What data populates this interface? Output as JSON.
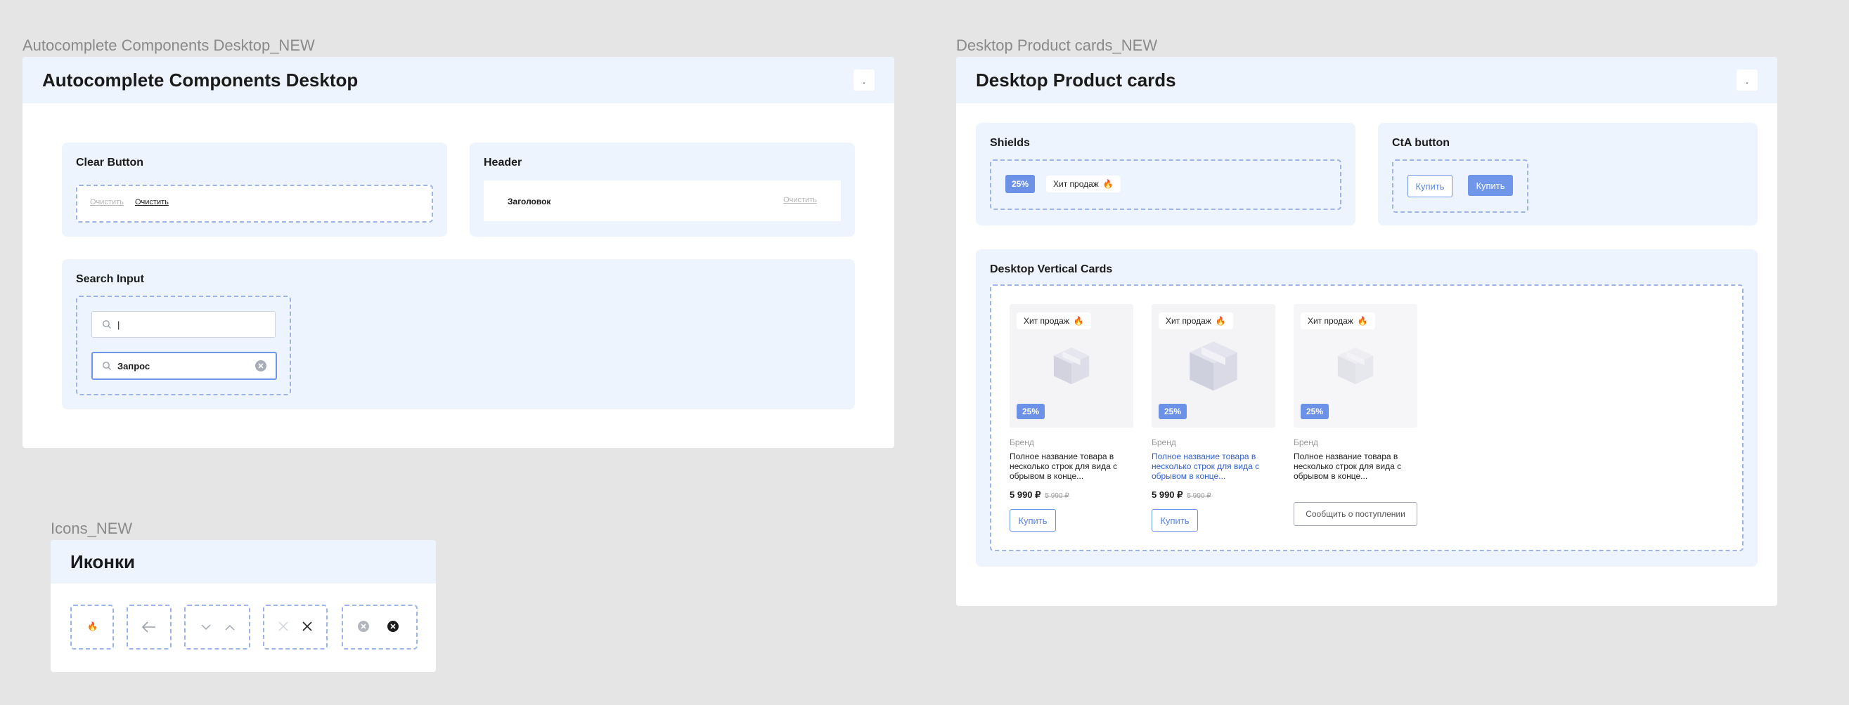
{
  "frames": {
    "autocomplete": {
      "label": "Autocomplete Components Desktop_NEW",
      "title": "Autocomplete Components Desktop",
      "dot": ".",
      "clear_button": {
        "title": "Clear Button",
        "disabled_label": "Очистить",
        "active_label": "Очистить"
      },
      "header": {
        "title": "Header",
        "heading": "Заголовок",
        "clear_label": "Очистить"
      },
      "search_input": {
        "title": "Search Input",
        "empty_value": "|",
        "filled_value": "Запрос"
      }
    },
    "icons": {
      "label": "Icons_NEW",
      "title": "Иконки",
      "items": [
        "fire-icon",
        "arrow-left-icon",
        "chevron-down-icon",
        "chevron-up-icon",
        "close-light-icon",
        "close-dark-icon",
        "clear-circle-grey-icon",
        "clear-circle-black-icon"
      ]
    },
    "product_cards": {
      "label": "Desktop Product cards_NEW",
      "title": "Desktop Product cards",
      "dot": ".",
      "shields": {
        "title": "Shields",
        "discount": "25%",
        "hit": "Хит продаж"
      },
      "cta": {
        "title": "CtA button",
        "outline_label": "Купить",
        "fill_label": "Купить"
      },
      "vertical_cards": {
        "title": "Desktop Vertical Cards",
        "cards": [
          {
            "hit": "Хит продаж",
            "discount": "25%",
            "brand": "Бренд",
            "name": "Полное название товара в несколько строк для вида с обрывом в конце...",
            "price": "5 990 ₽",
            "old_price": "5 990 ₽",
            "button": "Купить"
          },
          {
            "hit": "Хит продаж",
            "discount": "25%",
            "brand": "Бренд",
            "name": "Полное название товара в несколько строк для вида с обрывом в конце...",
            "price": "5 990 ₽",
            "old_price": "5 990 ₽",
            "button": "Купить"
          },
          {
            "hit": "Хит продаж",
            "discount": "25%",
            "brand": "Бренд",
            "name": "Полное название товара в несколько строк для вида с обрывом в конце...",
            "button": "Сообщить о поступлении"
          }
        ]
      }
    }
  },
  "colors": {
    "canvas": "#e5e5e5",
    "panel": "#eef4fd",
    "accent": "#7096ea",
    "dashed": "#9db4e8",
    "link": "#3461c9",
    "fire": "#f06a2e"
  }
}
